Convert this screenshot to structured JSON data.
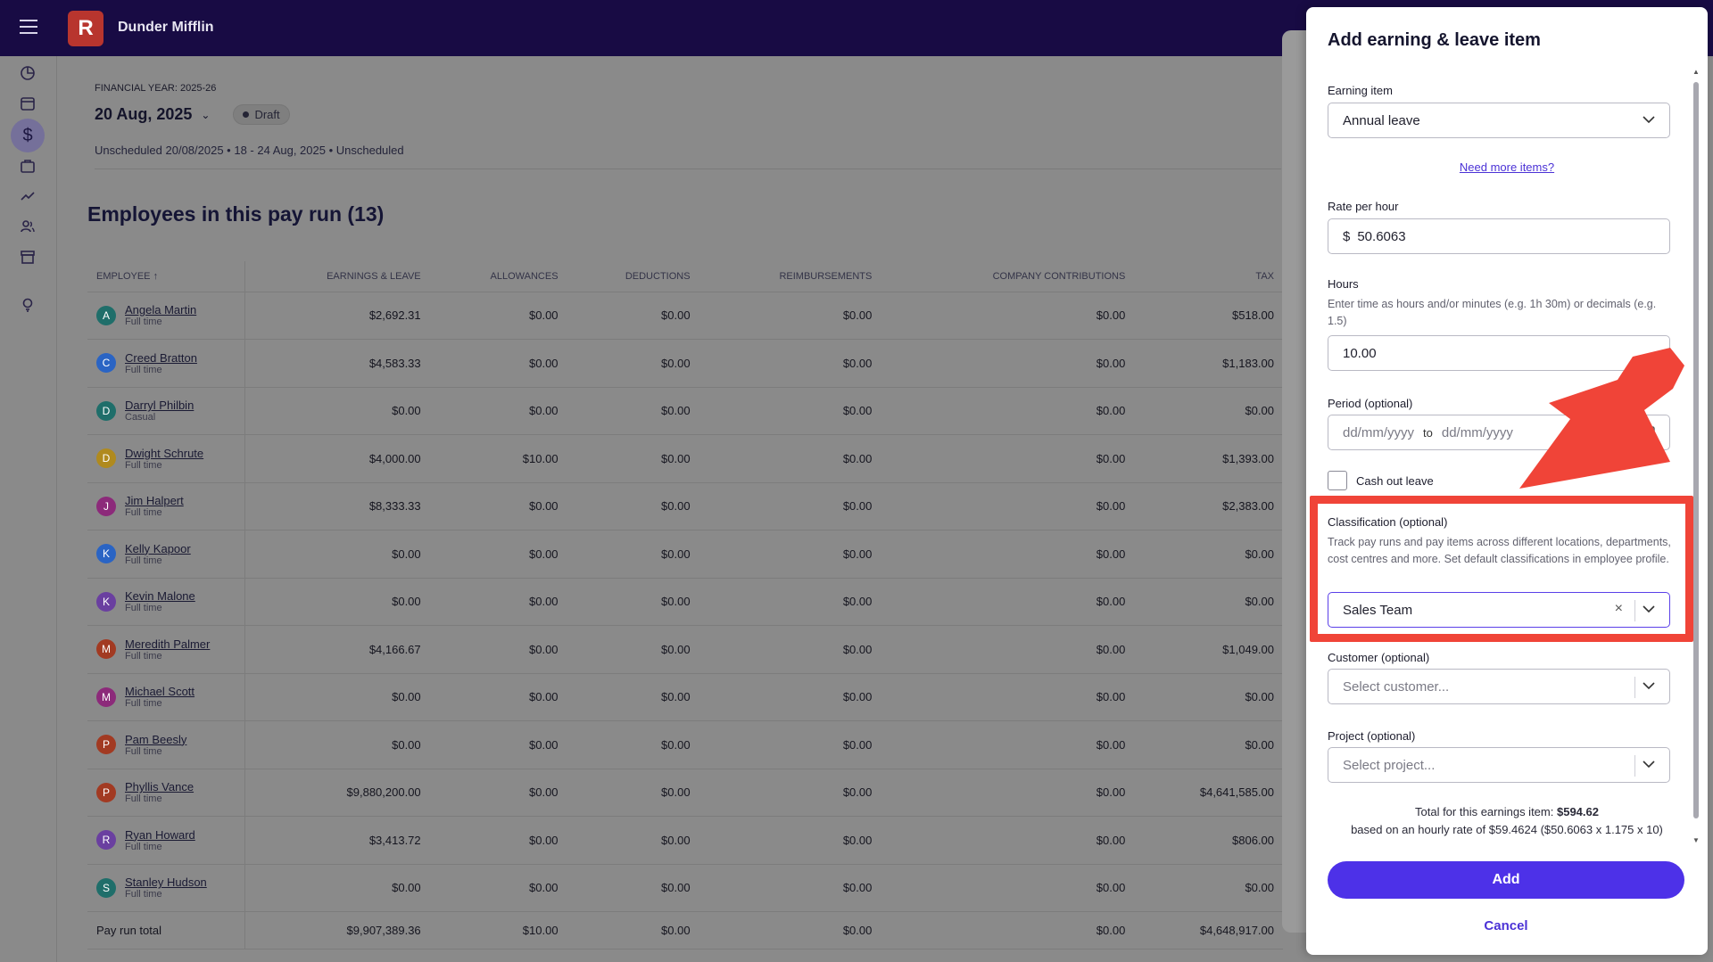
{
  "app": {
    "company": "Dunder Mifflin",
    "logo_letter": "R"
  },
  "payrun": {
    "financial_year": "FINANCIAL YEAR: 2025-26",
    "date": "20 Aug, 2025",
    "status": "Draft",
    "schedule": "Unscheduled 20/08/2025 • 18 - 24 Aug, 2025 • Unscheduled",
    "employees_title": "Employees in this pay run (13)"
  },
  "table": {
    "headers": [
      "EMPLOYEE ↑",
      "EARNINGS & LEAVE",
      "ALLOWANCES",
      "DEDUCTIONS",
      "REIMBURSEMENTS",
      "COMPANY CONTRIBUTIONS",
      "TAX"
    ],
    "rows": [
      {
        "initial": "A",
        "color": "#1f6e6a",
        "name": "Angela Martin",
        "type": "Full time",
        "earnings": "$2,692.31",
        "allowances": "$0.00",
        "deductions": "$0.00",
        "reimbursements": "$0.00",
        "contributions": "$0.00",
        "tax": "$518.00"
      },
      {
        "initial": "C",
        "color": "#2a64c4",
        "name": "Creed Bratton",
        "type": "Full time",
        "earnings": "$4,583.33",
        "allowances": "$0.00",
        "deductions": "$0.00",
        "reimbursements": "$0.00",
        "contributions": "$0.00",
        "tax": "$1,183.00"
      },
      {
        "initial": "D",
        "color": "#1f6e6a",
        "name": "Darryl Philbin",
        "type": "Casual",
        "earnings": "$0.00",
        "allowances": "$0.00",
        "deductions": "$0.00",
        "reimbursements": "$0.00",
        "contributions": "$0.00",
        "tax": "$0.00"
      },
      {
        "initial": "D",
        "color": "#b08a1e",
        "name": "Dwight Schrute",
        "type": "Full time",
        "earnings": "$4,000.00",
        "allowances": "$10.00",
        "deductions": "$0.00",
        "reimbursements": "$0.00",
        "contributions": "$0.00",
        "tax": "$1,393.00"
      },
      {
        "initial": "J",
        "color": "#8c2a7a",
        "name": "Jim Halpert",
        "type": "Full time",
        "earnings": "$8,333.33",
        "allowances": "$0.00",
        "deductions": "$0.00",
        "reimbursements": "$0.00",
        "contributions": "$0.00",
        "tax": "$2,383.00"
      },
      {
        "initial": "K",
        "color": "#2a64c4",
        "name": "Kelly Kapoor",
        "type": "Full time",
        "earnings": "$0.00",
        "allowances": "$0.00",
        "deductions": "$0.00",
        "reimbursements": "$0.00",
        "contributions": "$0.00",
        "tax": "$0.00"
      },
      {
        "initial": "K",
        "color": "#6a3fa0",
        "name": "Kevin Malone",
        "type": "Full time",
        "earnings": "$0.00",
        "allowances": "$0.00",
        "deductions": "$0.00",
        "reimbursements": "$0.00",
        "contributions": "$0.00",
        "tax": "$0.00"
      },
      {
        "initial": "M",
        "color": "#a23a22",
        "name": "Meredith Palmer",
        "type": "Full time",
        "earnings": "$4,166.67",
        "allowances": "$0.00",
        "deductions": "$0.00",
        "reimbursements": "$0.00",
        "contributions": "$0.00",
        "tax": "$1,049.00"
      },
      {
        "initial": "M",
        "color": "#8c2a7a",
        "name": "Michael Scott",
        "type": "Full time",
        "earnings": "$0.00",
        "allowances": "$0.00",
        "deductions": "$0.00",
        "reimbursements": "$0.00",
        "contributions": "$0.00",
        "tax": "$0.00"
      },
      {
        "initial": "P",
        "color": "#a23a22",
        "name": "Pam Beesly",
        "type": "Full time",
        "earnings": "$0.00",
        "allowances": "$0.00",
        "deductions": "$0.00",
        "reimbursements": "$0.00",
        "contributions": "$0.00",
        "tax": "$0.00"
      },
      {
        "initial": "P",
        "color": "#a23a22",
        "name": "Phyllis Vance",
        "type": "Full time",
        "earnings": "$9,880,200.00",
        "allowances": "$0.00",
        "deductions": "$0.00",
        "reimbursements": "$0.00",
        "contributions": "$0.00",
        "tax": "$4,641,585.00"
      },
      {
        "initial": "R",
        "color": "#6a3fa0",
        "name": "Ryan Howard",
        "type": "Full time",
        "earnings": "$3,413.72",
        "allowances": "$0.00",
        "deductions": "$0.00",
        "reimbursements": "$0.00",
        "contributions": "$0.00",
        "tax": "$806.00"
      },
      {
        "initial": "S",
        "color": "#1f6e6a",
        "name": "Stanley Hudson",
        "type": "Full time",
        "earnings": "$0.00",
        "allowances": "$0.00",
        "deductions": "$0.00",
        "reimbursements": "$0.00",
        "contributions": "$0.00",
        "tax": "$0.00"
      }
    ],
    "total": {
      "label": "Pay run total",
      "earnings": "$9,907,389.36",
      "allowances": "$10.00",
      "deductions": "$0.00",
      "reimbursements": "$0.00",
      "contributions": "$0.00",
      "tax": "$4,648,917.00"
    }
  },
  "modal": {
    "title": "Add earning & leave item",
    "earning_item_label": "Earning item",
    "earning_item_value": "Annual leave",
    "need_more": "Need more items?",
    "rate_label": "Rate per hour",
    "rate_currency": "$",
    "rate_value": "50.6063",
    "hours_label": "Hours",
    "hours_hint": "Enter time as hours and/or minutes (e.g. 1h 30m) or decimals (e.g. 1.5)",
    "hours_value": "10.00",
    "period_label": "Period (optional)",
    "period_from_placeholder": "dd/mm/yyyy",
    "period_to": "to",
    "period_to_placeholder": "dd/mm/yyyy",
    "cash_out_label": "Cash out leave",
    "classification_label": "Classification (optional)",
    "classification_hint": "Track pay runs and pay items across different locations, departments, cost centres and more. Set default classifications in employee profile.",
    "classification_value": "Sales Team",
    "customer_label": "Customer (optional)",
    "customer_placeholder": "Select customer...",
    "project_label": "Project (optional)",
    "project_placeholder": "Select project...",
    "total_prefix": "Total for this earnings item:",
    "total_value": "$594.62",
    "total_basis": "based on an hourly rate of $59.4624 ($50.6063 x 1.175 x 10)",
    "add_label": "Add",
    "cancel_label": "Cancel"
  },
  "colors": {
    "accent": "#4d31e8",
    "topbar": "#180b44",
    "annotation": "#f04438"
  }
}
